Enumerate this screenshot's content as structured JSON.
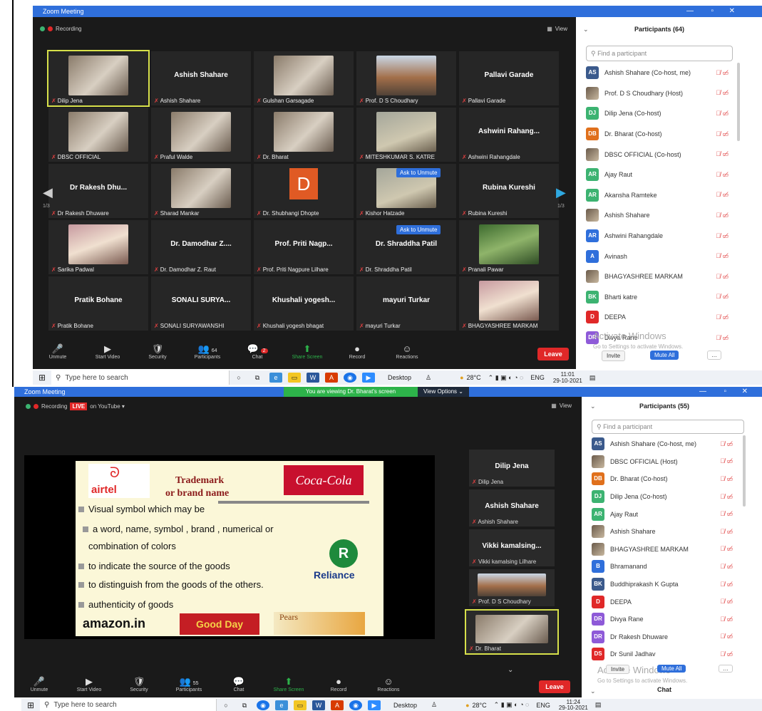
{
  "top": {
    "window_title": "Zoom Meeting",
    "recording_label": "Recording",
    "view_label": "View",
    "panel_title": "Participants (64)",
    "search_placeholder": "Find a participant",
    "page_left": "1/3",
    "page_right": "1/3",
    "unmute_badges": [
      "Ask to Unmute",
      "Ask to Unmute"
    ],
    "tiles": [
      {
        "name": "",
        "label": "Dilip Jena",
        "photo": "face"
      },
      {
        "name": "Ashish Shahare",
        "label": "Ashish Shahare",
        "photo": ""
      },
      {
        "name": "",
        "label": "Gulshan Garsagade",
        "photo": "face"
      },
      {
        "name": "",
        "label": "Prof. D S Choudhary",
        "photo": "bus"
      },
      {
        "name": "Pallavi Garade",
        "label": "Pallavi Garade",
        "photo": ""
      },
      {
        "name": "",
        "label": "DBSC OFFICIAL",
        "photo": "face"
      },
      {
        "name": "",
        "label": "Praful Walde",
        "photo": "face"
      },
      {
        "name": "",
        "label": "Dr. Bharat",
        "photo": "face"
      },
      {
        "name": "",
        "label": "MITESHKUMAR S. KATRE",
        "photo": "plant"
      },
      {
        "name": "Ashwini Rahang...",
        "label": "Ashwini Rahangdale",
        "photo": ""
      },
      {
        "name": "Dr Rakesh Dhu...",
        "label": "Dr Rakesh Dhuware",
        "photo": ""
      },
      {
        "name": "",
        "label": "Sharad Mankar",
        "photo": "face"
      },
      {
        "name": "",
        "label": "Dr. Shubhangi Dhopte",
        "photo": "D"
      },
      {
        "name": "",
        "label": "Kishor Hatzade",
        "photo": "plant"
      },
      {
        "name": "Rubina Kureshi",
        "label": "Rubina Kureshi",
        "photo": ""
      },
      {
        "name": "",
        "label": "Sarika Padwal",
        "photo": "woman"
      },
      {
        "name": "Dr. Damodhar Z....",
        "label": "Dr. Damodhar Z. Raut",
        "photo": ""
      },
      {
        "name": "Prof. Priti Nagp...",
        "label": "Prof. Priti Nagpure Lilhare",
        "photo": ""
      },
      {
        "name": "Dr. Shraddha Patil",
        "label": "Dr. Shraddha Patil",
        "photo": ""
      },
      {
        "name": "",
        "label": "Pranali Pawar",
        "photo": "green"
      },
      {
        "name": "Pratik Bohane",
        "label": "Pratik Bohane",
        "photo": ""
      },
      {
        "name": "SONALI SURYA...",
        "label": "SONALI SURYAWANSHI",
        "photo": ""
      },
      {
        "name": "Khushali yogesh...",
        "label": "Khushali yogesh bhagat",
        "photo": ""
      },
      {
        "name": "mayuri Turkar",
        "label": "mayuri Turkar",
        "photo": ""
      },
      {
        "name": "",
        "label": "BHAGYASHREE MARKAM",
        "photo": "woman"
      }
    ],
    "participants": [
      {
        "initials": "AS",
        "color": "#3b5a8c",
        "name": "Ashish Shahare (Co-host, me)"
      },
      {
        "initials": "",
        "color": "img",
        "name": "Prof. D S Choudhary (Host)"
      },
      {
        "initials": "DJ",
        "color": "#3cb371",
        "name": "Dilip Jena (Co-host)"
      },
      {
        "initials": "DB",
        "color": "#e0701c",
        "name": "Dr. Bharat (Co-host)"
      },
      {
        "initials": "",
        "color": "img",
        "name": "DBSC OFFICIAL (Co-host)"
      },
      {
        "initials": "AR",
        "color": "#3cb371",
        "name": "Ajay Raut"
      },
      {
        "initials": "AR",
        "color": "#3cb371",
        "name": "Akansha Ramteke"
      },
      {
        "initials": "",
        "color": "img",
        "name": "Ashish Shahare"
      },
      {
        "initials": "AR",
        "color": "#2f6fdb",
        "name": "Ashwini Rahangdale"
      },
      {
        "initials": "A",
        "color": "#2f6fdb",
        "name": "Avinash"
      },
      {
        "initials": "",
        "color": "img",
        "name": "BHAGYASHREE MARKAM"
      },
      {
        "initials": "BK",
        "color": "#3cb371",
        "name": "Bharti katre"
      },
      {
        "initials": "D",
        "color": "#e02828",
        "name": "DEEPA"
      },
      {
        "initials": "DR",
        "color": "#8e5ad8",
        "name": "Divya Rane"
      }
    ],
    "activate_overlay": "Activate Windows",
    "activate_sub": "Go to Settings to activate Windows.",
    "invite_label": "Invite",
    "mute_all_label": "Mute All",
    "toolbar": [
      {
        "icon": "🎤",
        "label": "Unmute"
      },
      {
        "icon": "▶",
        "label": "Start Video"
      },
      {
        "icon": "🛡",
        "label": "Security"
      },
      {
        "icon": "👥",
        "label": "Participants",
        "badge": "64"
      },
      {
        "icon": "💬",
        "label": "Chat",
        "badge": "2"
      },
      {
        "icon": "⬆",
        "label": "Share Screen"
      },
      {
        "icon": "●",
        "label": "Record"
      },
      {
        "icon": "☺",
        "label": "Reactions"
      }
    ],
    "leave_label": "Leave",
    "taskbar": {
      "search": "Type here to search",
      "desktop": "Desktop",
      "weather": "28°C",
      "lang": "ENG",
      "time": "11:01",
      "date": "29-10-2021"
    }
  },
  "bottom": {
    "window_title": "Zoom Meeting",
    "viewing_banner": "You are viewing Dr. Bharat's screen",
    "view_options": "View Options",
    "recording_label": "Recording",
    "live_label": "LIVE",
    "youtube_label": "on YouTube",
    "view_label": "View",
    "panel_title": "Participants (55)",
    "search_placeholder": "Find a participant",
    "slide": {
      "airtel": "airtel",
      "title1": "Trademark",
      "title2": "or brand name",
      "cocacola": "Coca-Cola",
      "reliance": "Reliance",
      "amazon": "amazon.in",
      "goodday": "Good Day",
      "pears": "Pears",
      "lines": [
        "Visual symbol which may be",
        "a word, name, symbol , brand , numerical or",
        "combination of colors",
        "to indicate the source of the goods",
        "to distinguish from the goods of the others.",
        "authenticity of goods"
      ]
    },
    "side_tiles": [
      {
        "name": "Dilip Jena",
        "label": "Dilip Jena"
      },
      {
        "name": "Ashish Shahare",
        "label": "Ashish Shahare"
      },
      {
        "name": "Vikki kamalsing...",
        "label": "Vikki kamalsing Lilhare"
      },
      {
        "name": "",
        "label": "Prof. D S Choudhary"
      },
      {
        "name": "",
        "label": "Dr. Bharat"
      }
    ],
    "participants": [
      {
        "initials": "AS",
        "color": "#3b5a8c",
        "name": "Ashish Shahare (Co-host, me)"
      },
      {
        "initials": "",
        "color": "img",
        "name": "DBSC OFFICIAL (Host)"
      },
      {
        "initials": "DB",
        "color": "#e0701c",
        "name": "Dr. Bharat (Co-host)"
      },
      {
        "initials": "DJ",
        "color": "#3cb371",
        "name": "Dilip Jena (Co-host)"
      },
      {
        "initials": "AR",
        "color": "#3cb371",
        "name": "Ajay Raut"
      },
      {
        "initials": "",
        "color": "img",
        "name": "Ashish Shahare"
      },
      {
        "initials": "",
        "color": "img",
        "name": "BHAGYASHREE MARKAM"
      },
      {
        "initials": "B",
        "color": "#2f6fdb",
        "name": "Bhramanand"
      },
      {
        "initials": "BK",
        "color": "#3b5a8c",
        "name": "Buddhiprakash K Gupta"
      },
      {
        "initials": "D",
        "color": "#e02828",
        "name": "DEEPA"
      },
      {
        "initials": "DR",
        "color": "#8e5ad8",
        "name": "Divya Rane"
      },
      {
        "initials": "DR",
        "color": "#8e5ad8",
        "name": "Dr Rakesh Dhuware"
      },
      {
        "initials": "DS",
        "color": "#e02828",
        "name": "Dr Sunil Jadhav"
      }
    ],
    "activate_overlay": "Activate Windows",
    "activate_sub": "Go to Settings to activate Windows.",
    "invite_label": "Invite",
    "mute_all_label": "Mute All",
    "chat_label": "Chat",
    "toolbar": [
      {
        "icon": "🎤",
        "label": "Unmute"
      },
      {
        "icon": "▶",
        "label": "Start Video"
      },
      {
        "icon": "🛡",
        "label": "Security"
      },
      {
        "icon": "👥",
        "label": "Participants",
        "badge": "55"
      },
      {
        "icon": "💬",
        "label": "Chat"
      },
      {
        "icon": "⬆",
        "label": "Share Screen"
      },
      {
        "icon": "●",
        "label": "Record"
      },
      {
        "icon": "☺",
        "label": "Reactions"
      }
    ],
    "leave_label": "Leave",
    "taskbar": {
      "search": "Type here to search",
      "desktop": "Desktop",
      "weather": "28°C",
      "lang": "ENG",
      "time": "11:24",
      "date": "29-10-2021"
    }
  }
}
